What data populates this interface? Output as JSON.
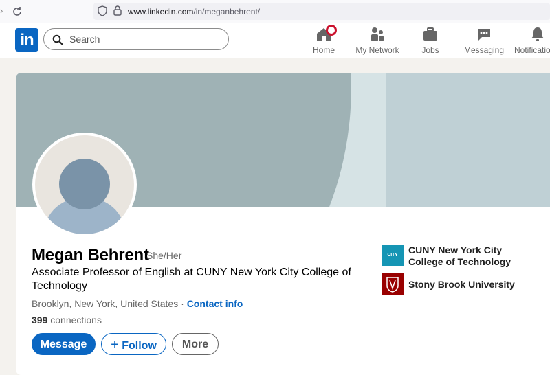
{
  "browser": {
    "url_host": "www.linkedin.com",
    "url_path": "/in/meganbehrent/"
  },
  "header": {
    "logo_text": "in",
    "search_placeholder": "Search",
    "nav": [
      {
        "label": "Home",
        "icon": "home-icon",
        "has_badge": true
      },
      {
        "label": "My Network",
        "icon": "network-icon"
      },
      {
        "label": "Jobs",
        "icon": "briefcase-icon"
      },
      {
        "label": "Messaging",
        "icon": "chat-icon"
      },
      {
        "label": "Notifications",
        "icon": "bell-icon"
      }
    ]
  },
  "profile": {
    "name": "Megan Behrent",
    "pronouns": "She/Her",
    "headline": "Associate Professor of English at CUNY New York City College of Technology",
    "location": "Brooklyn, New York, United States",
    "separator": "·",
    "contact_info": "Contact info",
    "connections_count": "399",
    "connections_label": "connections",
    "buttons": {
      "message": "Message",
      "follow": "Follow",
      "follow_icon": "+",
      "more": "More"
    },
    "organizations": [
      {
        "name": "CUNY New York City College of Technology",
        "logo_text": "CITY TECH",
        "logo_color": "#1595b4"
      },
      {
        "name": "Stony Brook University",
        "logo_color": "#990000"
      }
    ]
  },
  "colors": {
    "brand": "#0a66c2",
    "banner_light": "#bfd0d5",
    "banner_dark": "#9fb2b5"
  }
}
